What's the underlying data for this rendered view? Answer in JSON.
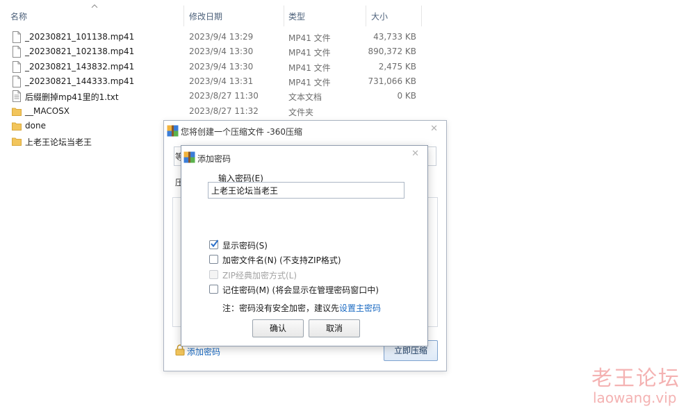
{
  "explorer": {
    "columns": {
      "name": "名称",
      "date": "修改日期",
      "type": "类型",
      "size": "大小"
    },
    "files": [
      {
        "name": "_20230821_101138.mp41",
        "date": "2023/9/4 13:29",
        "type": "MP41 文件",
        "size": "43,733 KB",
        "icon": "file-icon"
      },
      {
        "name": "_20230821_102138.mp41",
        "date": "2023/9/4 13:30",
        "type": "MP41 文件",
        "size": "890,372 KB",
        "icon": "file-icon"
      },
      {
        "name": "_20230821_143832.mp41",
        "date": "2023/9/4 13:30",
        "type": "MP41 文件",
        "size": "2,475 KB",
        "icon": "file-icon"
      },
      {
        "name": "_20230821_144333.mp41",
        "date": "2023/9/4 13:31",
        "type": "MP41 文件",
        "size": "731,066 KB",
        "icon": "file-icon"
      },
      {
        "name": "后缀删掉mp41里的1.txt",
        "date": "2023/8/27 11:30",
        "type": "文本文档",
        "size": "0 KB",
        "icon": "text-file-icon"
      },
      {
        "name": "__MACOSX",
        "date": "2023/8/27 11:32",
        "type": "文件夹",
        "size": "",
        "icon": "folder-icon"
      },
      {
        "name": "done",
        "date": "",
        "type": "",
        "size": "",
        "icon": "folder-icon"
      },
      {
        "name": "上老王论坛当老王",
        "date": "",
        "type": "",
        "size": "",
        "icon": "folder-icon"
      }
    ]
  },
  "archive_window": {
    "title": "您将创建一个压缩文件 -360压缩",
    "label_fragment_1": "等",
    "label_fragment_2": "压",
    "add_password_link": "添加密码",
    "compress_button": "立即压缩"
  },
  "password_dialog": {
    "title": "添加密码",
    "input_label": "输入密码(E)",
    "password_value": "上老王论坛当老王",
    "options": [
      {
        "label": "显示密码(S)",
        "checked": true,
        "disabled": false
      },
      {
        "label": "加密文件名(N) (不支持ZIP格式)",
        "checked": false,
        "disabled": false
      },
      {
        "label": "ZIP经典加密方式(L)",
        "checked": false,
        "disabled": true
      },
      {
        "label": "记住密码(M) (将会显示在管理密码窗口中)",
        "checked": false,
        "disabled": false
      }
    ],
    "note_prefix": "注：密码没有安全加密，建议先",
    "note_link": "设置主密码",
    "ok_button": "确认",
    "cancel_button": "取消"
  },
  "watermark": {
    "cn": "老王论坛",
    "en": "laowang.vip"
  },
  "colors": {
    "link": "#1a6ac2",
    "folder": "#f2c55c",
    "watermark": "#f4b2b2"
  }
}
